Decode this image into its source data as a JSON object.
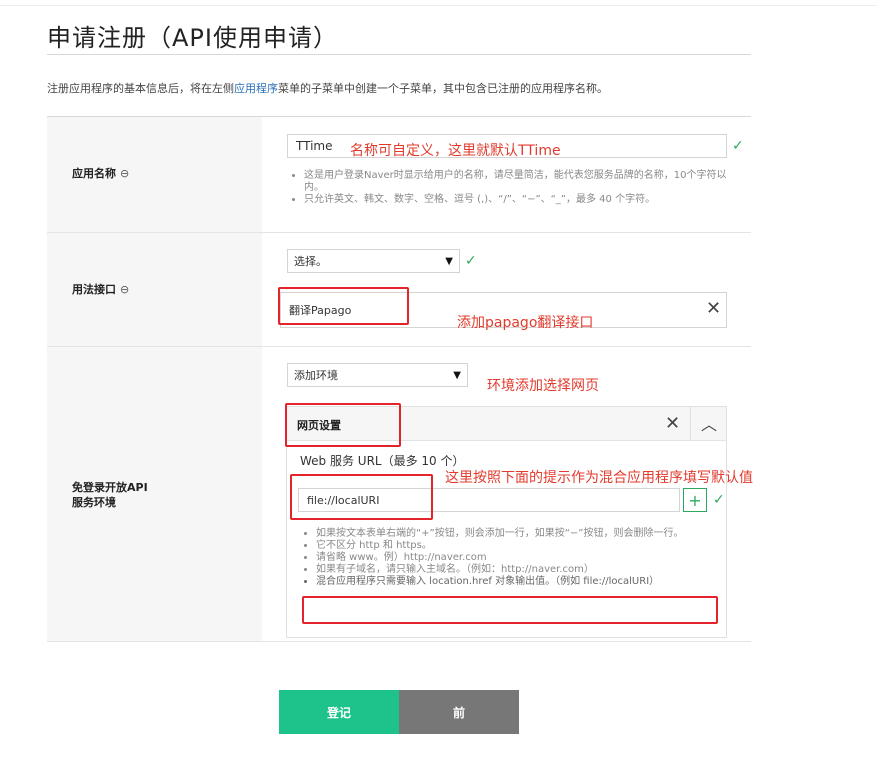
{
  "page": {
    "title": "申请注册（API使用申请）",
    "description_before": "注册应用程序的基本信息后，将在左侧",
    "description_link": "应用程序",
    "description_after": "菜单的子菜单中创建一个子菜单，其中包含已注册的应用程序名称。"
  },
  "app_name": {
    "label": "应用名称",
    "value": "TTime",
    "annotation": "名称可自定义，这里就默认TTime",
    "hints": [
      "这是用户登录Naver时显示给用户的名称，请尽量简洁，能代表您服务品牌的名称，10个字符以内。",
      "只允许英文、韩文、数字、空格、逗号 (,)、“/”、“−”、“_”，最多 40 个字符。"
    ]
  },
  "usage_api": {
    "label": "用法接口",
    "select_value": "选择。",
    "selected_item": "翻译Papago",
    "annotation": "添加papago翻译接口"
  },
  "environment": {
    "label_line1": "免登录开放API",
    "label_line2": "服务环境",
    "select_value": "添加环境",
    "annotation_env": "环境添加选择网页",
    "panel_title": "网页设置",
    "url_label": "Web 服务 URL（最多 10 个）",
    "url_value": "file://localURI",
    "annotation_url": "这里按照下面的提示作为混合应用程序填写默认值",
    "hints": [
      "如果按文本表单右端的“+”按钮，则会添加一行，如果按“−”按钮，则会删除一行。",
      "它不区分 http 和 https。",
      "请省略 www。例）http://naver.com",
      "如果有子域名，请只输入主域名。（例如：http://naver.com）",
      "混合应用程序只需要输入 location.href 对象输出值。（例如 file://localURI）"
    ]
  },
  "buttons": {
    "register": "登记",
    "back": "前"
  },
  "colors": {
    "register_bg": "#1ec28b",
    "back_bg": "#777777",
    "annotation_red": "#e23b2e",
    "check_green": "#2ea85f",
    "link_blue": "#2b6fb6"
  }
}
